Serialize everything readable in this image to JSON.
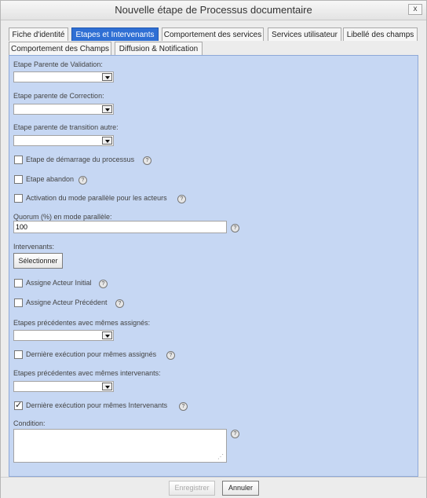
{
  "window": {
    "title": "Nouvelle étape de Processus documentaire",
    "close": "x"
  },
  "tabs": [
    {
      "label": "Fiche d'identité"
    },
    {
      "label": "Etapes et Intervenants"
    },
    {
      "label": "Comportement des services"
    },
    {
      "label": "Services utilisateur"
    },
    {
      "label": "Libellé des champs"
    },
    {
      "label": "Comportement des Champs"
    },
    {
      "label": "Diffusion & Notification"
    }
  ],
  "form": {
    "parent_validation_label": "Etape Parente de Validation:",
    "parent_correction_label": "Etape parente de Correction:",
    "parent_transition_label": "Etape parente de transition autre:",
    "start_step_label": "Etape de démarrage du processus",
    "abandon_label": "Etape abandon",
    "parallel_mode_label": "Activation du mode parallèle pour les acteurs",
    "quorum_label": "Quorum (%) en mode parallèle:",
    "quorum_value": "100",
    "intervenants_label": "Intervenants:",
    "select_button": "Sélectionner",
    "initial_actor_label": "Assigne Acteur Initial",
    "previous_actor_label": "Assigne Acteur Précédent",
    "prev_same_assigned_label": "Etapes précédentes avec mêmes assignés:",
    "last_exec_same_assigned_label": "Dernière exécution pour mêmes assignés",
    "prev_same_intervenants_label": "Etapes précédentes avec mêmes intervenants:",
    "last_exec_same_intervenants_label": "Dernière exécution pour mêmes Intervenants",
    "last_exec_same_intervenants_checked": true,
    "condition_label": "Condition:"
  },
  "help": "?",
  "footer": {
    "save": "Enregistrer",
    "cancel": "Annuler"
  }
}
